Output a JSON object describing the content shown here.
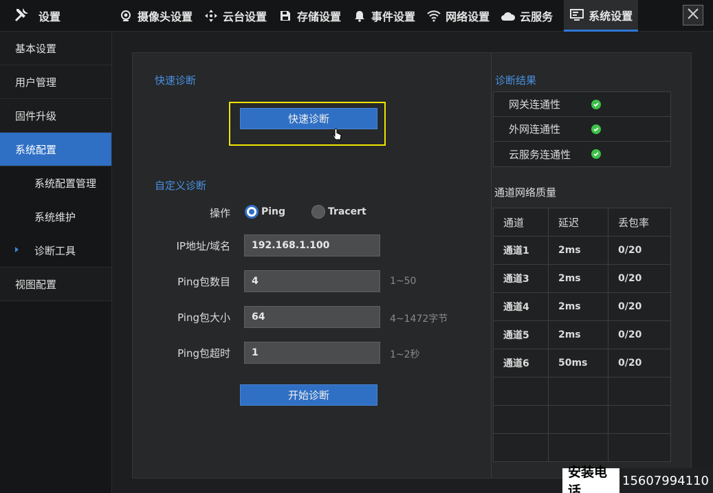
{
  "header": {
    "brand_label": "设置",
    "nav": [
      {
        "label": "摄像头设置",
        "icon": "camera-icon"
      },
      {
        "label": "云台设置",
        "icon": "ptz-arrows-icon"
      },
      {
        "label": "存储设置",
        "icon": "save-disk-icon"
      },
      {
        "label": "事件设置",
        "icon": "bell-icon"
      },
      {
        "label": "网络设置",
        "icon": "wifi-icon"
      },
      {
        "label": "云服务",
        "icon": "cloud-icon"
      },
      {
        "label": "系统设置",
        "icon": "monitor-icon",
        "active": true
      }
    ]
  },
  "sidebar": {
    "items": [
      {
        "label": "基本设置"
      },
      {
        "label": "用户管理"
      },
      {
        "label": "固件升级"
      },
      {
        "label": "系统配置",
        "active": true
      },
      {
        "label": "系统配置管理"
      },
      {
        "label": "系统维护"
      },
      {
        "label": "诊断工具"
      },
      {
        "label": "视图配置"
      }
    ]
  },
  "quick": {
    "title": "快速诊断",
    "button_label": "快速诊断"
  },
  "custom": {
    "title": "自定义诊断",
    "operation_label": "操作",
    "radio_ping": "Ping",
    "radio_tracert": "Tracert",
    "selected": "Ping",
    "ip_label": "IP地址/域名",
    "ip_value": "192.168.1.100",
    "count_label": "Ping包数目",
    "count_value": "4",
    "count_hint": "1~50",
    "size_label": "Ping包大小",
    "size_value": "64",
    "size_hint": "4~1472字节",
    "timeout_label": "Ping包超时",
    "timeout_value": "1",
    "timeout_hint": "1~2秒",
    "start_button": "开始诊断"
  },
  "results": {
    "title": "诊断结果",
    "rows": [
      {
        "label": "网关连通性",
        "status": "ok"
      },
      {
        "label": "外网连通性",
        "status": "ok"
      },
      {
        "label": "云服务连通性",
        "status": "ok"
      }
    ]
  },
  "quality": {
    "title": "通道网络质量",
    "columns": [
      "通道",
      "延迟",
      "丢包率"
    ],
    "rows": [
      [
        "通道1",
        "2ms",
        "0/20"
      ],
      [
        "通道3",
        "2ms",
        "0/20"
      ],
      [
        "通道4",
        "2ms",
        "0/20"
      ],
      [
        "通道5",
        "2ms",
        "0/20"
      ],
      [
        "通道6",
        "50ms",
        "0/20"
      ],
      [
        "",
        "",
        ""
      ],
      [
        "",
        "",
        ""
      ],
      [
        "",
        "",
        ""
      ]
    ]
  },
  "contact": {
    "label": "安装电话",
    "number": "15607994110"
  },
  "colors": {
    "accent": "#2f6fc4",
    "section_title": "#4a90e2",
    "highlight": "#f2e600",
    "ok": "#3ec14a"
  }
}
